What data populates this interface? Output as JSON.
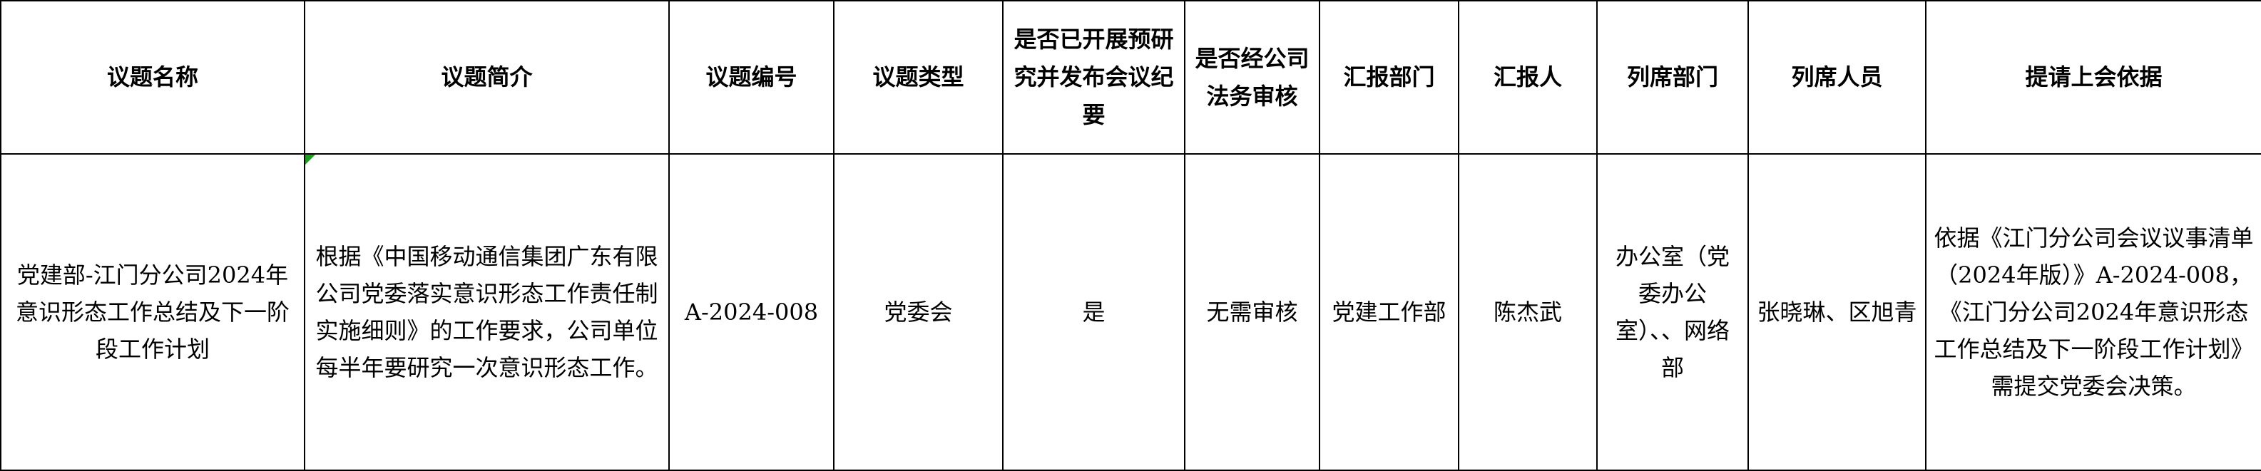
{
  "headers": [
    "议题名称",
    "议题简介",
    "议题编号",
    "议题类型",
    "是否已开展预研究并发布会议纪要",
    "是否经公司法务审核",
    "汇报部门",
    "汇报人",
    "列席部门",
    "列席人员",
    "提请上会依据"
  ],
  "row": {
    "name": "党建部-江门分公司2024年意识形态工作总结及下一阶段工作计划",
    "intro": "根据《中国移动通信集团广东有限公司党委落实意识形态工作责任制实施细则》的工作要求，公司单位每半年要研究一次意识形态工作。",
    "code": "A-2024-008",
    "type": "党委会",
    "pre_research": "是",
    "legal_review": "无需审核",
    "report_dept": "党建工作部",
    "reporter": "陈杰武",
    "attend_dept": "办公室（党委办公室）、、网络部",
    "attendees": "张晓琳、区旭青",
    "basis": "依据《江门分公司会议议事清单（2024年版）》A-2024-008，《江门分公司2024年意识形态工作总结及下一阶段工作计划》需提交党委会决策。"
  },
  "colors": {
    "border": "#000000",
    "comment_marker": "#1e9e1e"
  }
}
